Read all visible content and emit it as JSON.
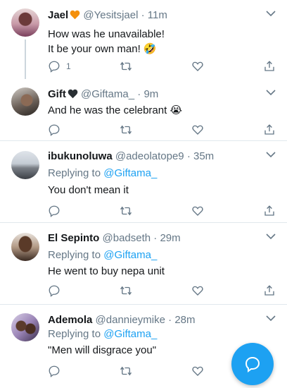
{
  "tweets": [
    {
      "name": "Jael",
      "name_emoji": "orange-heart",
      "handle": "@Yesitsjael",
      "time": "11m",
      "reply_to_label": "",
      "reply_to_handle": "",
      "lines": [
        "How was he unavailable!",
        "It be your own man! 🤣"
      ],
      "reply_count": "1"
    },
    {
      "name": "Gift",
      "name_emoji": "black-heart",
      "handle": "@Giftama_",
      "time": "9m",
      "reply_to_label": "",
      "reply_to_handle": "",
      "lines": [
        "And he was the celebrant 😭"
      ],
      "reply_count": ""
    },
    {
      "name": "ibukunoluwa",
      "name_emoji": "",
      "handle": "@adeolatope9",
      "time": "35m",
      "reply_to_label": "Replying to",
      "reply_to_handle": "@Giftama_",
      "lines": [
        "You don't mean it"
      ],
      "reply_count": ""
    },
    {
      "name": "El Sepinto",
      "name_emoji": "",
      "handle": "@badseth",
      "time": "29m",
      "reply_to_label": "Replying to",
      "reply_to_handle": "@Giftama_",
      "lines": [
        "He went to buy nepa unit"
      ],
      "reply_count": ""
    },
    {
      "name": "Ademola",
      "name_emoji": "",
      "handle": "@dannieymike",
      "time": "28m",
      "reply_to_label": "Replying to",
      "reply_to_handle": "@Giftama_",
      "lines": [
        "\"Men will disgrace you\""
      ],
      "reply_count": ""
    }
  ],
  "separator": "·",
  "colors": {
    "accent": "#1da1f2",
    "secondary_text": "#657786",
    "divider": "#e1e8ed"
  },
  "icons": {
    "reply": "reply-icon",
    "retweet": "retweet-icon",
    "like": "like-icon",
    "share": "share-icon",
    "menu": "chevron-down-icon",
    "compose": "compose-reply-icon"
  }
}
